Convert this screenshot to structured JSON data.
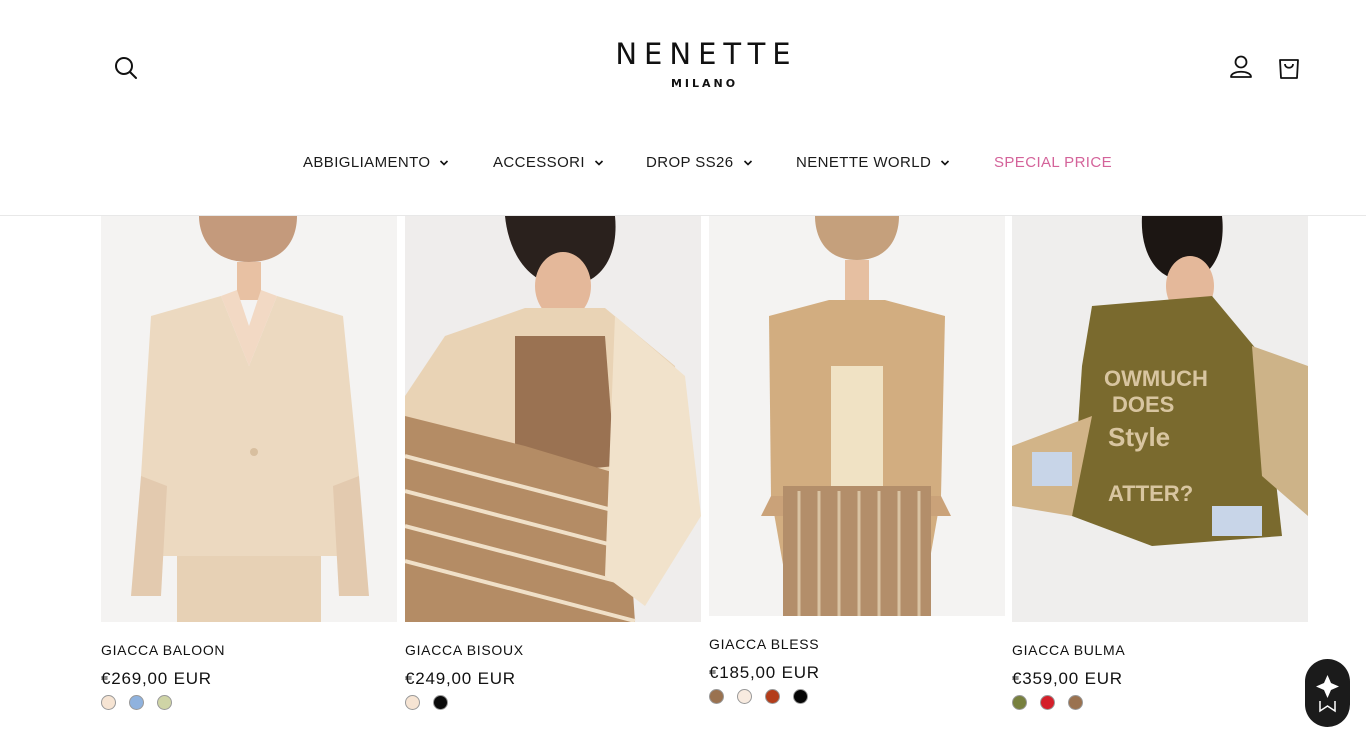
{
  "brand": {
    "name": "NENETTE",
    "city": "MILANO"
  },
  "nav": {
    "items": [
      {
        "label": "ABBIGLIAMENTO"
      },
      {
        "label": "ACCESSORI"
      },
      {
        "label": "DROP SS26"
      },
      {
        "label": "NENETTE WORLD"
      },
      {
        "label": "SPECIAL PRICE"
      }
    ]
  },
  "icons": {
    "search": "search-icon",
    "account": "user-icon",
    "cart": "shopping-bag-icon",
    "chevron": "chevron-down-icon",
    "chat": "chat-widget-icon"
  },
  "colors": {
    "special": "#d4639a",
    "chat_bg": "#1b1b1b"
  },
  "products": [
    {
      "name": "GIACCA BALOON",
      "price": "€269,00 EUR",
      "swatches": [
        "#f6e4d3",
        "#8fb2de",
        "#cfd4a6"
      ],
      "image": "woman in cream blazer"
    },
    {
      "name": "GIACCA BISOUX",
      "price": "€249,00 EUR",
      "swatches": [
        "#f6e4d3",
        "#0a0a0a"
      ],
      "image": "woman seated in beige jacket and striped trousers"
    },
    {
      "name": "GIACCA BLESS",
      "price": "€185,00 EUR",
      "swatches": [
        "#9a7250",
        "#f8ebe0",
        "#b33d1b",
        "#050505"
      ],
      "image": "woman in camel blazer"
    },
    {
      "name": "GIACCA BULMA",
      "price": "€359,00 EUR",
      "swatches": [
        "#77803e",
        "#d41f2a",
        "#9a7250"
      ],
      "image": "woman in olive embroidered jacket"
    }
  ]
}
